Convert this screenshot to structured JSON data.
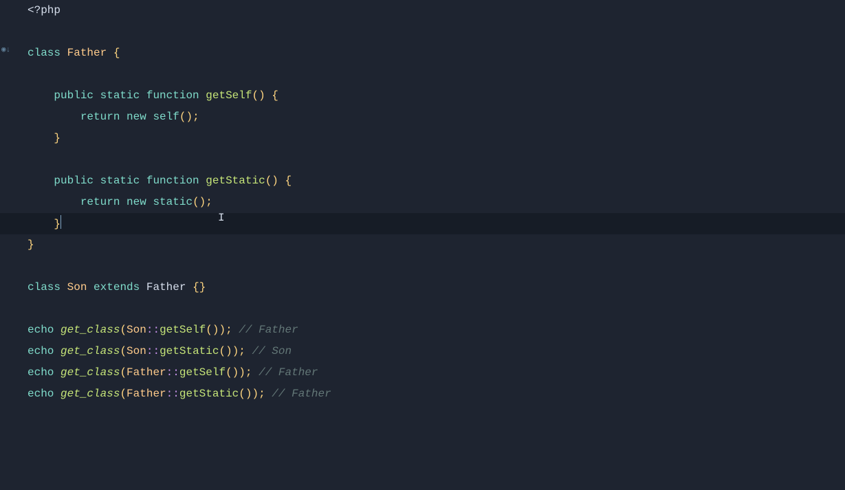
{
  "code": {
    "lines": [
      {
        "indent": 0,
        "tokens": [
          {
            "t": "<?php",
            "c": "def"
          }
        ]
      },
      {
        "indent": 0,
        "tokens": []
      },
      {
        "indent": 0,
        "tokens": [
          {
            "t": "class",
            "c": "kw"
          },
          {
            "t": " ",
            "c": "def"
          },
          {
            "t": "Father",
            "c": "cls"
          },
          {
            "t": " ",
            "c": "def"
          },
          {
            "t": "{",
            "c": "br"
          }
        ]
      },
      {
        "indent": 0,
        "tokens": []
      },
      {
        "indent": 1,
        "tokens": [
          {
            "t": "public",
            "c": "kw"
          },
          {
            "t": " ",
            "c": "def"
          },
          {
            "t": "static",
            "c": "kw"
          },
          {
            "t": " ",
            "c": "def"
          },
          {
            "t": "function",
            "c": "kw"
          },
          {
            "t": " ",
            "c": "def"
          },
          {
            "t": "getSelf",
            "c": "fn"
          },
          {
            "t": "()",
            "c": "br"
          },
          {
            "t": " ",
            "c": "def"
          },
          {
            "t": "{",
            "c": "br"
          }
        ]
      },
      {
        "indent": 2,
        "tokens": [
          {
            "t": "return",
            "c": "kw"
          },
          {
            "t": " ",
            "c": "def"
          },
          {
            "t": "new",
            "c": "kw"
          },
          {
            "t": " ",
            "c": "def"
          },
          {
            "t": "self",
            "c": "kw"
          },
          {
            "t": "();",
            "c": "br"
          }
        ]
      },
      {
        "indent": 1,
        "tokens": [
          {
            "t": "}",
            "c": "br"
          }
        ]
      },
      {
        "indent": 0,
        "tokens": []
      },
      {
        "indent": 1,
        "tokens": [
          {
            "t": "public",
            "c": "kw"
          },
          {
            "t": " ",
            "c": "def"
          },
          {
            "t": "static",
            "c": "kw"
          },
          {
            "t": " ",
            "c": "def"
          },
          {
            "t": "function",
            "c": "kw"
          },
          {
            "t": " ",
            "c": "def"
          },
          {
            "t": "getStatic",
            "c": "fn"
          },
          {
            "t": "()",
            "c": "br"
          },
          {
            "t": " ",
            "c": "def"
          },
          {
            "t": "{",
            "c": "br"
          }
        ]
      },
      {
        "indent": 2,
        "tokens": [
          {
            "t": "return",
            "c": "kw"
          },
          {
            "t": " ",
            "c": "def"
          },
          {
            "t": "new",
            "c": "kw"
          },
          {
            "t": " ",
            "c": "def"
          },
          {
            "t": "static",
            "c": "kw"
          },
          {
            "t": "();",
            "c": "br"
          }
        ]
      },
      {
        "indent": 1,
        "tokens": [
          {
            "t": "}",
            "c": "br"
          }
        ],
        "highlight": true,
        "caret": true
      },
      {
        "indent": 0,
        "tokens": [
          {
            "t": "}",
            "c": "br"
          }
        ]
      },
      {
        "indent": 0,
        "tokens": []
      },
      {
        "indent": 0,
        "tokens": [
          {
            "t": "class",
            "c": "kw"
          },
          {
            "t": " ",
            "c": "def"
          },
          {
            "t": "Son",
            "c": "cls"
          },
          {
            "t": " ",
            "c": "def"
          },
          {
            "t": "extends",
            "c": "kw"
          },
          {
            "t": " ",
            "c": "def"
          },
          {
            "t": "Father",
            "c": "def"
          },
          {
            "t": " ",
            "c": "def"
          },
          {
            "t": "{}",
            "c": "br"
          }
        ]
      },
      {
        "indent": 0,
        "tokens": []
      },
      {
        "indent": 0,
        "tokens": [
          {
            "t": "echo",
            "c": "kw"
          },
          {
            "t": " ",
            "c": "def"
          },
          {
            "t": "get_class",
            "c": "fnit"
          },
          {
            "t": "(",
            "c": "br"
          },
          {
            "t": "Son",
            "c": "cls"
          },
          {
            "t": "::",
            "c": "op"
          },
          {
            "t": "getSelf",
            "c": "fn"
          },
          {
            "t": "());",
            "c": "br"
          },
          {
            "t": " ",
            "c": "def"
          },
          {
            "t": "// Father",
            "c": "com"
          }
        ]
      },
      {
        "indent": 0,
        "tokens": [
          {
            "t": "echo",
            "c": "kw"
          },
          {
            "t": " ",
            "c": "def"
          },
          {
            "t": "get_class",
            "c": "fnit"
          },
          {
            "t": "(",
            "c": "br"
          },
          {
            "t": "Son",
            "c": "cls"
          },
          {
            "t": "::",
            "c": "op"
          },
          {
            "t": "getStatic",
            "c": "fn"
          },
          {
            "t": "());",
            "c": "br"
          },
          {
            "t": " ",
            "c": "def"
          },
          {
            "t": "// Son",
            "c": "com"
          }
        ]
      },
      {
        "indent": 0,
        "tokens": [
          {
            "t": "echo",
            "c": "kw"
          },
          {
            "t": " ",
            "c": "def"
          },
          {
            "t": "get_class",
            "c": "fnit"
          },
          {
            "t": "(",
            "c": "br"
          },
          {
            "t": "Father",
            "c": "cls"
          },
          {
            "t": "::",
            "c": "op"
          },
          {
            "t": "getSelf",
            "c": "fn"
          },
          {
            "t": "());",
            "c": "br"
          },
          {
            "t": " ",
            "c": "def"
          },
          {
            "t": "// Father",
            "c": "com"
          }
        ]
      },
      {
        "indent": 0,
        "tokens": [
          {
            "t": "echo",
            "c": "kw"
          },
          {
            "t": " ",
            "c": "def"
          },
          {
            "t": "get_class",
            "c": "fnit"
          },
          {
            "t": "(",
            "c": "br"
          },
          {
            "t": "Father",
            "c": "cls"
          },
          {
            "t": "::",
            "c": "op"
          },
          {
            "t": "getStatic",
            "c": "fn"
          },
          {
            "t": "());",
            "c": "br"
          },
          {
            "t": " ",
            "c": "def"
          },
          {
            "t": "// Father",
            "c": "com"
          }
        ]
      }
    ]
  },
  "gutter": {
    "icon": "◉↓"
  }
}
